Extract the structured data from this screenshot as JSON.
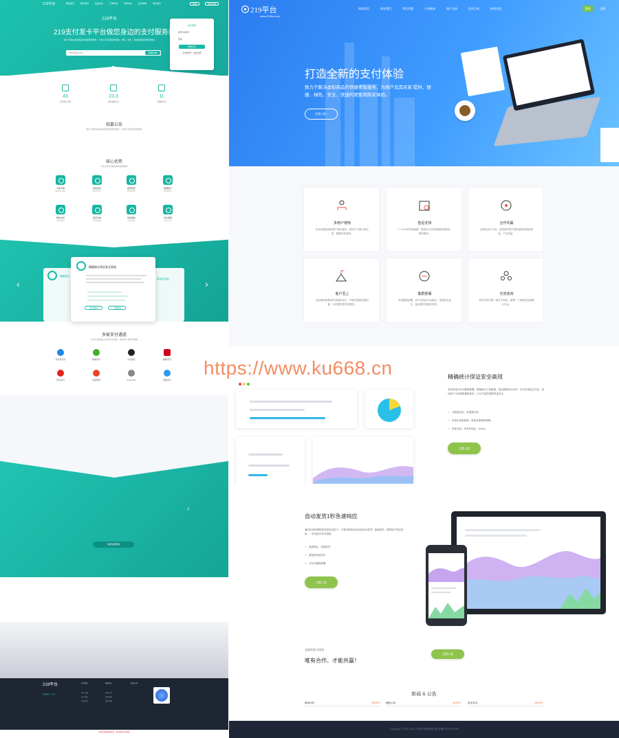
{
  "left": {
    "logo": "219平台",
    "nav": [
      "网站首页",
      "服务项目",
      "商品列表",
      "订单查询",
      "新闻动态",
      "投诉举报",
      "联系我们"
    ],
    "login": "登录",
    "register": "免费注册",
    "headline": "219支付发卡平台做您身边的支付服务商",
    "subtext": "致力于解决虚拟商品的快捷寄售服务，为商户及买家提供便捷、绿色、安全、快速的销售和购买体验。",
    "search_placeholder": "订单号/联系方式",
    "search_btn": "查询订单",
    "card_title": "商户登录",
    "card_user": "账号/手机号",
    "card_pass": "密码",
    "card_btn": "登录平台",
    "card_foot": "没有账号？立即注册",
    "stats": [
      {
        "num": "43",
        "label": "已有商户(家)"
      },
      {
        "num": "23.3",
        "label": "交易金额(万)"
      },
      {
        "num": "11",
        "label": "已服务(天)"
      }
    ],
    "notice_title": "招募公告",
    "notice_sub": "致力于解决虚拟商品的快捷寄售服务，为商户及买家提供服务",
    "core_title": "核心优势",
    "core_sub": "平台为商户提供多种优质服务",
    "features": [
      {
        "label": "卡密卡券",
        "desc": "虚拟商品自动发货"
      },
      {
        "label": "极速发货",
        "desc": "毫秒级自动发卡"
      },
      {
        "label": "结算稳定",
        "desc": "结算周期稳定"
      },
      {
        "label": "数据统计",
        "desc": "精准数据分析"
      },
      {
        "label": "服务支持",
        "desc": "专业客服团队"
      },
      {
        "label": "稳定高效",
        "desc": "分布式服务架构"
      },
      {
        "label": "持续更新",
        "desc": "功能持续迭代"
      },
      {
        "label": "安全保障",
        "desc": "多重安全防护"
      }
    ],
    "slide_title": "精确统计保证安全高效",
    "slide_left": "精确统计",
    "slide_right": "保证安全高",
    "slide_btn1": "实时更新",
    "slide_btn2": "了解更多",
    "pay_title": "多家支付通道",
    "pay_sub": "平台已对接各大主流支付通道，满足商户多样化需求",
    "payments": [
      "支付宝支付",
      "微信支付",
      "QQ钱包",
      "银联支付",
      "京东支付",
      "百度钱包",
      "Apple Pay",
      "其他支付"
    ],
    "band_btn": "免费注册使用",
    "footer_logo": "219平台",
    "footer_cols": [
      "关于我们",
      "帮助中心",
      "联系方式"
    ],
    "footer_links": [
      "商户注册",
      "商户登录",
      "订单查询",
      "投诉订单",
      "新闻动态",
      "常见问题"
    ],
    "footer_contact": "QQ客服：xxxxxx",
    "footer_warning": "本站仅提供技术支持，请勿用于非法用途"
  },
  "right": {
    "logo": "219平台",
    "logo_sub": "www.219ka.com",
    "nav": [
      "网站首页",
      "联系我们",
      "常见问题",
      "订单查询",
      "商户注册",
      "投诉订单",
      "新闻文档"
    ],
    "login": "登录",
    "register": "注册",
    "headline": "打造全新的支付体验",
    "subtext": "致力于解决虚拟商品的快捷寄售服务，为商户及其买家 提供，便捷、绿色、安全、快速的销售和购买体验。",
    "hero_btn": "立即入驻 ›",
    "boxes": [
      {
        "title": "多用户使用",
        "desc": "来自全国各地的商户都在使用，超过千万级订单交易，覆盖所有领域。"
      },
      {
        "title": "售后支持",
        "desc": "7 X 24小时在线客服，提供全方位的使用指导服务，随时联系。"
      },
      {
        "title": "合作共赢",
        "desc": "全新的发卡平台，给您更好更方便的虚拟货物的商品，产生收益。"
      },
      {
        "title": "客户至上",
        "desc": "自动需求就是我们发展的动力，不断的更新完善功能，为您提供更好的服务。"
      },
      {
        "title": "集群部署",
        "desc": "系统集群部署，多节点保证平台稳定，快速安全运行，保证更好的服务效率。"
      },
      {
        "title": "交流咨询",
        "desc": "我们不仅仅是一家发卡网站，更是一个商家的自我展示平台。"
      }
    ],
    "sec3_title": "精确统计保证安全高效",
    "sec3_text": "系统采用分布式集群部署，精确统计订单数据，保证数据永不丢失！支付系统独立开发，保证每个平台都是最新版本，24小时监控保障资金安全",
    "sec3_checks": [
      "大数据支持，多维度分析。",
      "多样化资金管理，资金来源清晰明确。",
      "资金日结，安全有保证。design"
    ],
    "sec3_btn": "立即入驻",
    "sec4_title": "自动发货1秒急速响应",
    "sec4_text": "通过轮询回调机制完成自动发卡，订单付款成功后系统自动发货！极速发货，保障用户购买体验，一件商品可多次销售。",
    "sec4_checks": [
      "极速响应，快速发货",
      "微信和系统同步",
      "分布式集群部署"
    ],
    "sec4_btn": "立即入驻",
    "sec5_small": "全新的发卡体验",
    "sec5_title": "唯有合作、才能共赢！",
    "sec5_btn": "立即入驻",
    "news_title": "新闻 & 公告",
    "news_cols": [
      {
        "title": "新闻动态",
        "more": "MORE+"
      },
      {
        "title": "通知公告",
        "more": "MORE+"
      },
      {
        "title": "技术支持",
        "more": "MORE+"
      }
    ],
    "copyright": "Copyright © 2020-2021 219发卡联邦科技 浙ICP备XXXXXXXX号"
  },
  "watermark": "https://www.ku668.cn",
  "colors": {
    "teal": "#1ab9a6",
    "blue": "#3f8df5",
    "green": "#8ec44c",
    "dark": "#1e2638"
  }
}
